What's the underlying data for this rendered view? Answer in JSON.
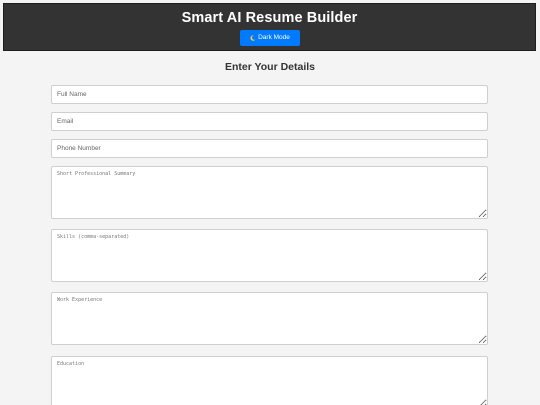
{
  "header": {
    "title": "Smart AI Resume Builder",
    "dark_mode_label": "Dark Mode"
  },
  "colors": {
    "header_bg": "#333333",
    "accent": "#007bff",
    "page_bg": "#f4f4f4"
  },
  "icons": {
    "dark_mode": "moon-icon"
  },
  "form": {
    "title": "Enter Your Details",
    "full_name_placeholder": "Full Name",
    "email_placeholder": "Email",
    "phone_placeholder": "Phone Number",
    "summary_placeholder": "Short Professional Summary",
    "skills_placeholder": "Skills (comma-separated)",
    "experience_placeholder": "Work Experience",
    "education_placeholder": "Education"
  }
}
